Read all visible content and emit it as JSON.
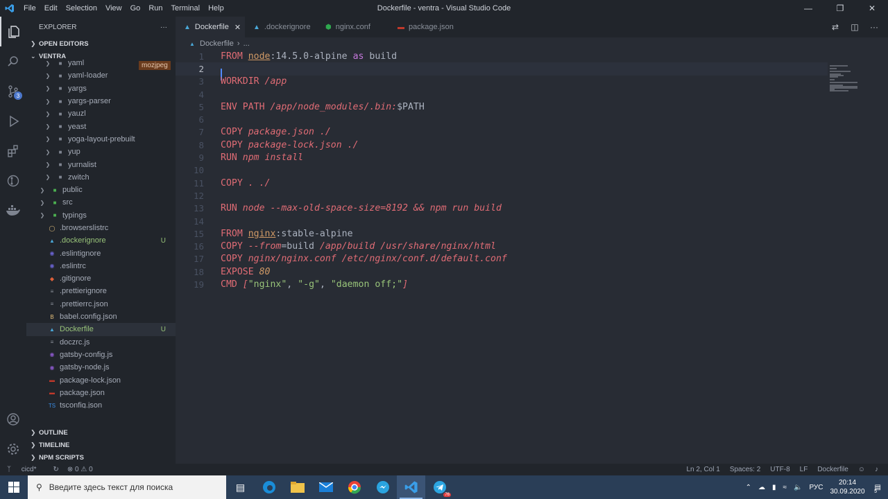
{
  "window": {
    "title": "Dockerfile - ventra - Visual Studio Code",
    "menu": [
      "File",
      "Edit",
      "Selection",
      "View",
      "Go",
      "Run",
      "Terminal",
      "Help"
    ]
  },
  "activity_bar": {
    "scm_badge": "3"
  },
  "sidebar": {
    "header": "EXPLORER",
    "more": "···",
    "open_editors": "OPEN EDITORS",
    "project": "VENTRA",
    "tooltip": "mozjpeg",
    "items": [
      {
        "label": "yaml",
        "kind": "folder",
        "indent": 2
      },
      {
        "label": "yaml-loader",
        "kind": "folder",
        "indent": 2
      },
      {
        "label": "yargs",
        "kind": "folder",
        "indent": 2
      },
      {
        "label": "yargs-parser",
        "kind": "folder",
        "indent": 2
      },
      {
        "label": "yauzl",
        "kind": "folder",
        "indent": 2
      },
      {
        "label": "yeast",
        "kind": "folder",
        "indent": 2
      },
      {
        "label": "yoga-layout-prebuilt",
        "kind": "folder",
        "indent": 2
      },
      {
        "label": "yup",
        "kind": "folder",
        "indent": 2
      },
      {
        "label": "yurnalist",
        "kind": "folder",
        "indent": 2
      },
      {
        "label": "zwitch",
        "kind": "folder",
        "indent": 2
      },
      {
        "label": "public",
        "kind": "folder-green",
        "indent": 1
      },
      {
        "label": "src",
        "kind": "folder-green",
        "indent": 1
      },
      {
        "label": "typings",
        "kind": "folder-ts",
        "indent": 1
      },
      {
        "label": ".browserslistrc",
        "kind": "file-yellow",
        "indent": 1
      },
      {
        "label": ".dockerignore",
        "kind": "file-docker",
        "indent": 1,
        "git": "U",
        "green": true
      },
      {
        "label": ".eslintignore",
        "kind": "file-eslint",
        "indent": 1
      },
      {
        "label": ".eslintrc",
        "kind": "file-eslint",
        "indent": 1
      },
      {
        "label": ".gitignore",
        "kind": "file-git",
        "indent": 1
      },
      {
        "label": ".prettierignore",
        "kind": "file-generic",
        "indent": 1
      },
      {
        "label": ".prettierrc.json",
        "kind": "file-generic",
        "indent": 1
      },
      {
        "label": "babel.config.json",
        "kind": "file-babel",
        "indent": 1
      },
      {
        "label": "Dockerfile",
        "kind": "file-docker",
        "indent": 1,
        "git": "U",
        "selected": true
      },
      {
        "label": "doczrc.js",
        "kind": "file-generic",
        "indent": 1
      },
      {
        "label": "gatsby-config.js",
        "kind": "file-gatsby",
        "indent": 1
      },
      {
        "label": "gatsby-node.js",
        "kind": "file-gatsby",
        "indent": 1
      },
      {
        "label": "package-lock.json",
        "kind": "file-npm",
        "indent": 1
      },
      {
        "label": "package.json",
        "kind": "file-npm",
        "indent": 1
      },
      {
        "label": "tsconfig.json",
        "kind": "file-ts",
        "indent": 1
      }
    ],
    "outline": "OUTLINE",
    "timeline": "TIMELINE",
    "npm_scripts": "NPM SCRIPTS"
  },
  "tabs": [
    {
      "label": "Dockerfile",
      "icon": "docker",
      "active": true
    },
    {
      "label": ".dockerignore",
      "icon": "docker"
    },
    {
      "label": "nginx.conf",
      "icon": "nginx"
    },
    {
      "label": "package.json",
      "icon": "npm"
    }
  ],
  "breadcrumb": {
    "file": "Dockerfile",
    "rest": "..."
  },
  "editor": {
    "lines": [
      [
        [
          "kw",
          "FROM "
        ],
        [
          "img",
          "node"
        ],
        [
          "wh",
          ":14.5.0-alpine "
        ],
        [
          "kw2",
          "as"
        ],
        [
          "wh",
          " build"
        ]
      ],
      [],
      [
        [
          "kw",
          "WORKDIR "
        ],
        [
          "it",
          "/app"
        ]
      ],
      [],
      [
        [
          "kw",
          "ENV "
        ],
        [
          "kw",
          "PATH "
        ],
        [
          "it",
          "/app/node_modules/.bin:"
        ],
        [
          "wh",
          "$PATH"
        ]
      ],
      [],
      [
        [
          "kw",
          "COPY "
        ],
        [
          "it",
          "package.json ./"
        ]
      ],
      [
        [
          "kw",
          "COPY "
        ],
        [
          "it",
          "package-lock.json ./"
        ]
      ],
      [
        [
          "kw",
          "RUN "
        ],
        [
          "it",
          "npm install"
        ]
      ],
      [],
      [
        [
          "kw",
          "COPY "
        ],
        [
          "it",
          ". ./"
        ]
      ],
      [],
      [
        [
          "kw",
          "RUN "
        ],
        [
          "it",
          "node --max-old-space-size=8192 && npm run build"
        ]
      ],
      [],
      [
        [
          "kw",
          "FROM "
        ],
        [
          "img",
          "nginx"
        ],
        [
          "wh",
          ":stable-alpine"
        ]
      ],
      [
        [
          "kw",
          "COPY "
        ],
        [
          "it",
          "--from"
        ],
        [
          "wh",
          "=build "
        ],
        [
          "it",
          "/app/build /usr/share/nginx/html"
        ]
      ],
      [
        [
          "kw",
          "COPY "
        ],
        [
          "it",
          "nginx/nginx.conf /etc/nginx/conf.d/default.conf"
        ]
      ],
      [
        [
          "kw",
          "EXPOSE "
        ],
        [
          "num2",
          "80"
        ]
      ],
      [
        [
          "kw",
          "CMD "
        ],
        [
          "it",
          "["
        ],
        [
          "str",
          "\"nginx\""
        ],
        [
          "wh",
          ", "
        ],
        [
          "str",
          "\"-g\""
        ],
        [
          "wh",
          ", "
        ],
        [
          "str",
          "\"daemon off;\""
        ],
        [
          "it",
          "]"
        ]
      ]
    ],
    "current_line": 2
  },
  "statusbar": {
    "branch": "cicd*",
    "problems": "⊗ 0 ⚠ 0",
    "position": "Ln 2, Col 1",
    "spaces": "Spaces: 2",
    "encoding": "UTF-8",
    "eol": "LF",
    "language": "Dockerfile"
  },
  "taskbar": {
    "search_placeholder": "Введите здесь текст для поиска",
    "lang": "РУС",
    "time": "20:14",
    "date": "30.09.2020",
    "notifications": "5",
    "telegram_badge": "76"
  },
  "colors": {
    "keyword": "#e06c75",
    "string": "#98c379",
    "accent": "#528bff"
  }
}
